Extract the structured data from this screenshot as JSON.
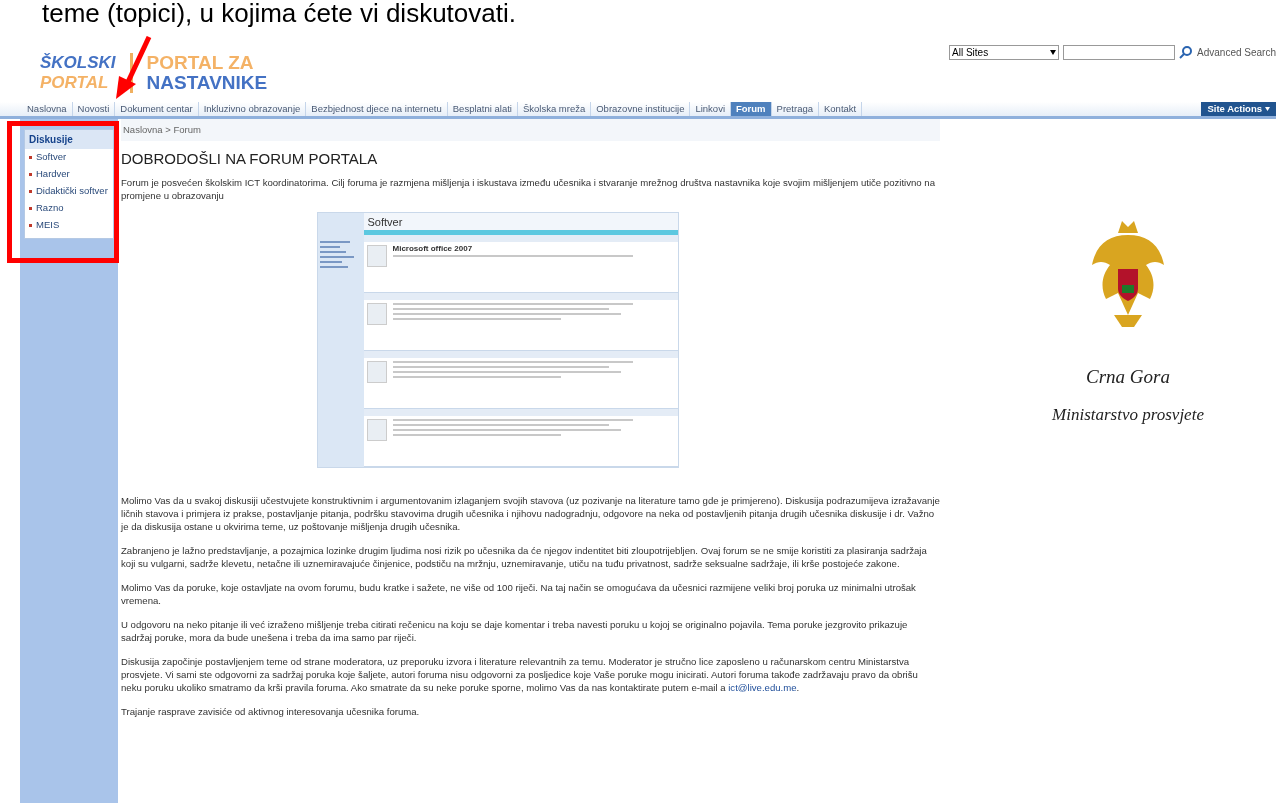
{
  "slide_text": "teme (topici), u kojima ćete vi diskutovati.",
  "logo": {
    "left_line1": "ŠKOLSKI",
    "left_line2": "PORTAL",
    "right_line1": "PORTAL ZA",
    "right_line2": "NASTAVNIKE"
  },
  "search": {
    "scope": "All Sites",
    "link": "Advanced Search"
  },
  "nav": [
    {
      "label": "Naslovna",
      "selected": false
    },
    {
      "label": "Novosti",
      "selected": false
    },
    {
      "label": "Dokument centar",
      "selected": false
    },
    {
      "label": "Inkluzivno obrazovanje",
      "selected": false
    },
    {
      "label": "Bezbjednost djece na internetu",
      "selected": false
    },
    {
      "label": "Besplatni alati",
      "selected": false
    },
    {
      "label": "Školska mreža",
      "selected": false
    },
    {
      "label": "Obrazovne institucije",
      "selected": false
    },
    {
      "label": "Linkovi",
      "selected": false
    },
    {
      "label": "Forum",
      "selected": true
    },
    {
      "label": "Pretraga",
      "selected": false
    },
    {
      "label": "Kontakt",
      "selected": false
    }
  ],
  "site_actions": "Site Actions",
  "sidebar": {
    "title": "Diskusije",
    "items": [
      "Softver",
      "Hardver",
      "Didaktički softver",
      "Razno",
      "MEIS"
    ]
  },
  "breadcrumb": "Naslovna > Forum",
  "heading": "DOBRODOŠLI NA FORUM PORTALA",
  "intro": "Forum je posvećen školskim ICT koordinatorima. Cilj foruma je razmjena mišljenja i iskustava između učesnika i stvaranje mrežnog društva nastavnika koje svojim mišljenjem utiče pozitivno na promjene u obrazovanju",
  "embedded": {
    "title": "Softver",
    "post_title": "Microsoft office 2007"
  },
  "paragraphs": [
    "Molimo Vas da u svakoj diskusiji učestvujete konstruktivnim i argumentovanim izlaganjem svojih stavova (uz pozivanje na literature tamo gde je primjereno). Diskusija podrazumijeva izražavanje ličnih stavova i primjera iz prakse, postavljanje pitanja, podršku stavovima drugih učesnika i njihovu nadogradnju, odgovore na neka od postavljenih pitanja drugih učesnika diskusije i dr. Važno je da diskusija ostane u okvirima teme, uz poštovanje mišljenja drugih učesnika.",
    "Zabranjeno je lažno predstavljanje, a pozajmica lozinke drugim ljudima nosi rizik po učesnika da će njegov indentitet biti zloupotrijebljen. Ovaj forum se ne smije koristiti za plasiranja sadržaja koji su vulgarni, sadrže klevetu, netačne ili uznemiravajuće činjenice, podstiču na mržnju, uznemiravanje, utiču na tuđu privatnost, sadrže seksualne sadržaje, ili krše postojeće zakone.",
    "Molimo Vas da poruke, koje ostavljate na ovom forumu, budu kratke i sažete, ne više od 100 riječi. Na taj način se omogućava da učesnici razmijene veliki broj poruka uz minimalni utrošak vremena.",
    "U odgovoru na neko pitanje ili već izraženo mišljenje treba citirati rečenicu na koju se daje komentar i treba navesti poruku u kojoj se originalno pojavila. Tema poruke jezgrovito prikazuje sadržaj poruke, mora da bude unešena i treba da ima samo par riječi."
  ],
  "moderation": {
    "text": "Diskusija započinje postavljenjem teme od strane moderatora, uz preporuku izvora i literature relevantnih za temu. Moderator je stručno lice zaposleno u računarskom centru Ministarstva prosvjete. Vi sami ste odgovorni za sadržaj poruka koje šaljete, autori foruma nisu odgovorni za posljedice koje Vaše poruke mogu inicirati. Autori foruma takođe zadržavaju pravo da obrišu neku poruku ukoliko smatramo da krši pravila foruma. Ako smatrate da su neke poruke sporne, molimo Vas da nas kontaktirate putem e-mail a",
    "link": "ict@live.edu.me",
    "end": "."
  },
  "closing": "Trajanje rasprave zavisiće od aktivnog interesovanja učesnika foruma.",
  "emblem": {
    "line1": "Crna Gora",
    "line2": "Ministarstvo prosvjete"
  }
}
